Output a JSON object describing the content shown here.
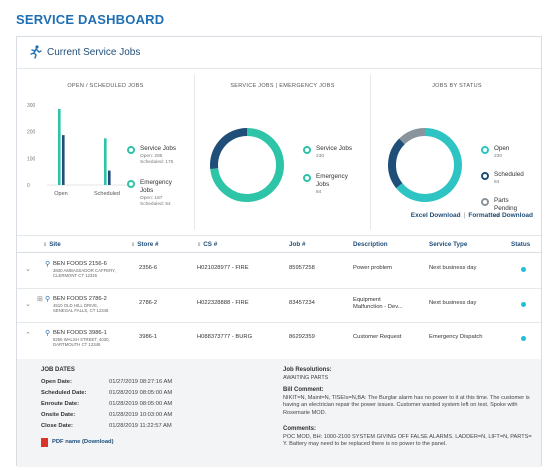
{
  "page_title": "SERVICE DASHBOARD",
  "section_title": "Current Service Jobs",
  "panels": {
    "open_scheduled": {
      "title": "OPEN / SCHEDULED JOBS",
      "y_ticks": [
        "300",
        "200",
        "100",
        "0"
      ],
      "categories": [
        "Open",
        "Scheduled"
      ],
      "legend": [
        {
          "label": "Service Jobs",
          "sub1": "Open: 285",
          "sub2": "Scheduled: 175"
        },
        {
          "label": "Emergency Jobs",
          "sub1": "Open: 187",
          "sub2": "Scheduled: 54"
        }
      ]
    },
    "service_emergency": {
      "title": "SERVICE JOBS | EMERGENCY JOBS",
      "legend": [
        {
          "label": "Service Jobs",
          "sub": "230"
        },
        {
          "label": "Emergency Jobs",
          "sub": "84"
        }
      ]
    },
    "by_status": {
      "title": "JOBS BY STATUS",
      "legend": [
        {
          "label": "Open",
          "sub": "230"
        },
        {
          "label": "Scheduled",
          "sub": "84"
        },
        {
          "label": "Parts Pending",
          "sub": "44"
        }
      ]
    }
  },
  "chart_data": [
    {
      "type": "bar",
      "title": "OPEN / SCHEDULED JOBS",
      "categories": [
        "Open",
        "Scheduled"
      ],
      "series": [
        {
          "name": "Service Jobs",
          "values": [
            285,
            175
          ],
          "color": "#2ec4a8"
        },
        {
          "name": "Emergency Jobs",
          "values": [
            187,
            54
          ],
          "color": "#1f4e79"
        }
      ],
      "ylim": [
        0,
        300
      ],
      "grid": false
    },
    {
      "type": "pie",
      "title": "SERVICE JOBS | EMERGENCY JOBS",
      "labels": [
        "Service Jobs",
        "Emergency Jobs"
      ],
      "values": [
        230,
        84
      ],
      "colors": [
        "#2ec4a8",
        "#1f4e79"
      ]
    },
    {
      "type": "pie",
      "title": "JOBS BY STATUS",
      "labels": [
        "Open",
        "Scheduled",
        "Parts Pending"
      ],
      "values": [
        230,
        84,
        44
      ],
      "colors": [
        "#2ec4c4",
        "#1f4e79",
        "#8a949c"
      ]
    }
  ],
  "downloads": {
    "excel": "Excel Download",
    "formatted": "Formatted Download"
  },
  "table": {
    "headers": [
      "Site",
      "Store #",
      "CS #",
      "Job #",
      "Description",
      "Service Type",
      "Status"
    ],
    "rows": [
      {
        "site": "BEN FOODS 2156-6",
        "addr1": "3830 AMBASSADOR CAFFERY,",
        "addr2": "CLERMONT CT 12345",
        "store": "2356-6",
        "cs": "H021028977 - FIRE",
        "job": "85957258",
        "desc": "Power problem",
        "desc2": "",
        "service": "Next business day"
      },
      {
        "site": "BEN FOODS 2786-2",
        "addr1": "4510 OLD HILL DRIVE,",
        "addr2": "SENEGAL FALLS, CT 12345",
        "store": "2786-2",
        "cs": "H022328888 - FIRE",
        "job": "83457234",
        "desc": "Equipment",
        "desc2": "Malfunction - Dev...",
        "service": "Next business day"
      },
      {
        "site": "BEN FOODS 3986-1",
        "addr1": "8256 WALSH STREET, 4030,",
        "addr2": "DARTMOUTH CT 12345",
        "store": "3986-1",
        "cs": "H088373777 - BURG",
        "job": "86292359",
        "desc": "Customer Request",
        "desc2": "",
        "service": "Emergency Dispatch"
      }
    ]
  },
  "detail": {
    "job_dates_title": "JOB DATES",
    "dates": [
      {
        "k": "Open Date:",
        "v": "01/27/2019 08:27:16 AM"
      },
      {
        "k": "Scheduled Date:",
        "v": "01/28/2019 08:05:00 AM"
      },
      {
        "k": "Enroute Date:",
        "v": "01/28/2019 08:05:00 AM"
      },
      {
        "k": "Onsite Date:",
        "v": "01/28/2019 10:03:00 AM"
      },
      {
        "k": "Close Date:",
        "v": "01/28/2019 11:22:57 AM"
      }
    ],
    "pdf_label": "PDF name (Download)",
    "resolution_title": "Job Resolutions:",
    "resolution_value": "AWAITING PARTS",
    "bill_title": "Bill Comment:",
    "bill_text": "NIKIT=N, Maint=N, TISEIs=N,BA: The Burglar alarm has no power to it at this time. The customer is having an electrician repair the power issues. Customer wanted system left on test. Spoke with Rosemarie MOD.",
    "comments_title": "Comments:",
    "comments_text": "POC MOD, BH: 1000-2100 SYSTEM GIVING OFF FALSE ALARMS. LADDER=N, LIFT=N, PARTS= Y. Battery may need to be replaced there is no power to the panel."
  }
}
